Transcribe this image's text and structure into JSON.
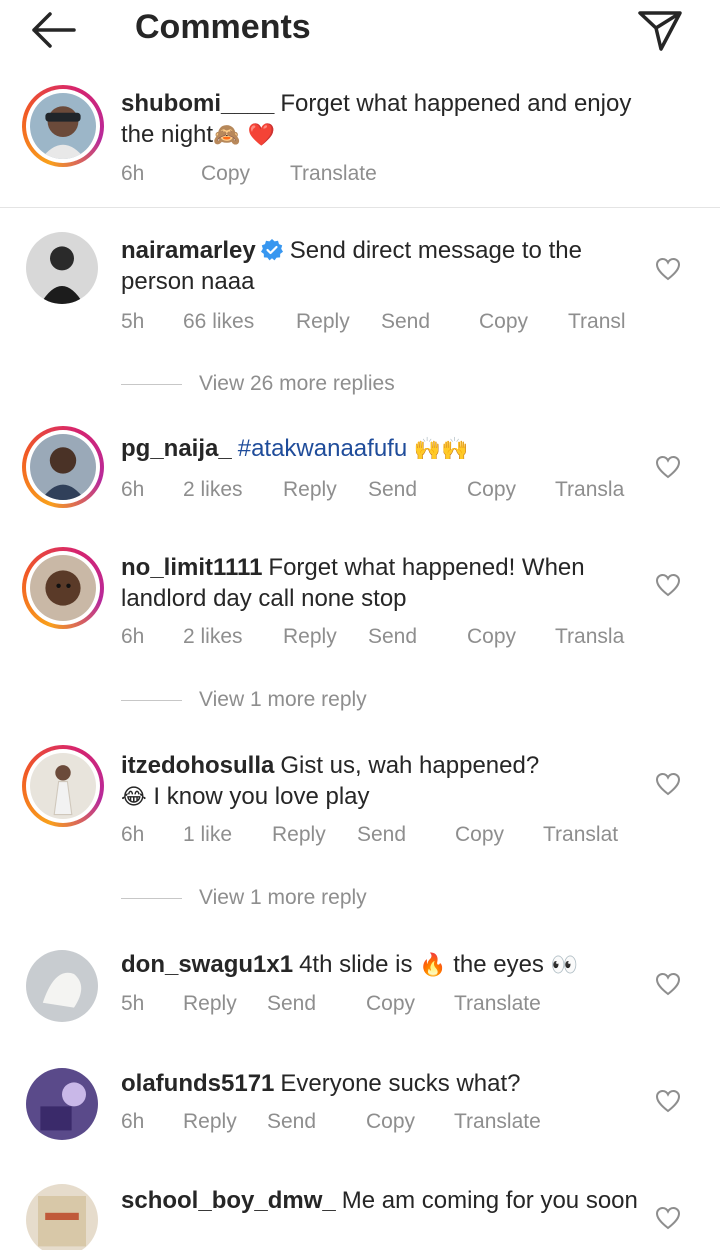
{
  "header": {
    "title": "Comments"
  },
  "caption": {
    "username": "shubomi____",
    "text": "Forget what happened and enjoy the night",
    "emoji": "🙈      ❤️",
    "time": "6h",
    "copy": "Copy",
    "translate": "Translate"
  },
  "comments": [
    {
      "username": "nairamarley",
      "text": "Send direct message to the person naaa",
      "time": "5h",
      "likes": "66 likes",
      "reply": "Reply",
      "send": "Send",
      "copy": "Copy",
      "translate": "Transl",
      "more_replies": "View 26 more replies"
    },
    {
      "username": "pg_naija_",
      "hashtag": "#atakwanaafufu",
      "emoji": "🙌🙌",
      "time": "6h",
      "likes": "2 likes",
      "reply": "Reply",
      "send": "Send",
      "copy": "Copy",
      "translate": "Transla"
    },
    {
      "username": "no_limit1111",
      "text": "Forget what happened! When landlord day call none stop",
      "time": "6h",
      "likes": "2 likes",
      "reply": "Reply",
      "send": "Send",
      "copy": "Copy",
      "translate": "Transla",
      "more_replies": "View 1 more reply"
    },
    {
      "username": "itzedohosulla",
      "text": "Gist us, wah happened?",
      "emoji": "😂",
      "text2": "I know you love play",
      "time": "6h",
      "likes": "1 like",
      "reply": "Reply",
      "send": "Send",
      "copy": "Copy",
      "translate": "Translat",
      "more_replies": "View 1 more reply"
    },
    {
      "username": "don_swagu1x1",
      "text": "4th slide is",
      "emoji": "🔥",
      "text2": "the eyes",
      "emoji2": "👀",
      "time": "5h",
      "reply": "Reply",
      "send": "Send",
      "copy": "Copy",
      "translate": "Translate"
    },
    {
      "username": "olafunds5171",
      "text": "Everyone sucks what?",
      "time": "6h",
      "reply": "Reply",
      "send": "Send",
      "copy": "Copy",
      "translate": "Translate"
    },
    {
      "username": "school_boy_dmw_",
      "text": "Me am coming for you soon"
    }
  ],
  "colors": {
    "text": "#262626",
    "muted": "#8e8e8e",
    "hashtag": "#1f4c9a",
    "verified": "#3897f0",
    "heart": "#e5242a"
  }
}
